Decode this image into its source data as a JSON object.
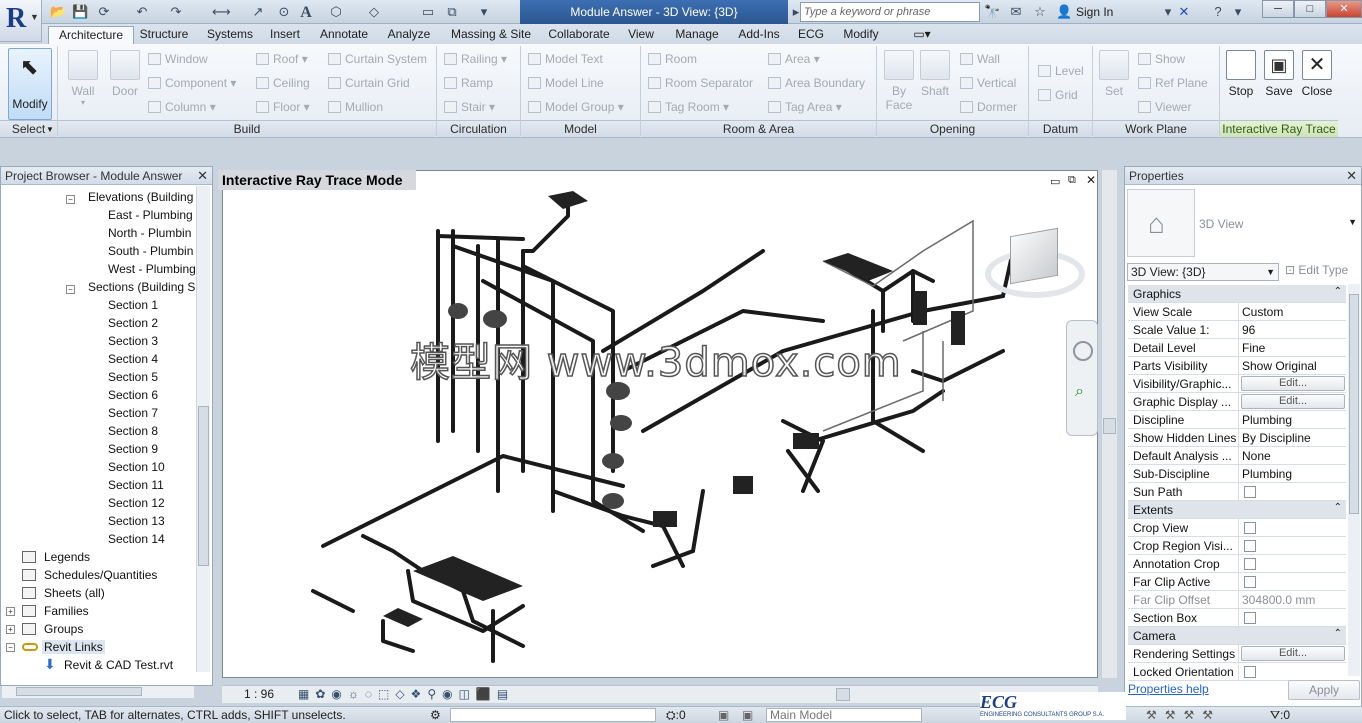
{
  "app": {
    "logo": "R",
    "title": "Module Answer - 3D View: {3D}",
    "search_placeholder": "Type a keyword or phrase",
    "sign_in": "Sign In"
  },
  "tabs": [
    "Architecture",
    "Structure",
    "Systems",
    "Insert",
    "Annotate",
    "Analyze",
    "Massing & Site",
    "Collaborate",
    "View",
    "Manage",
    "Add-Ins",
    "ECG",
    "Modify"
  ],
  "ribbon": {
    "modify": "Modify",
    "build": {
      "wall": "Wall",
      "door": "Door",
      "window": "Window",
      "component": "Component",
      "column": "Column",
      "roof": "Roof",
      "ceiling": "Ceiling",
      "floor": "Floor",
      "curtain_system": "Curtain System",
      "curtain_grid": "Curtain Grid",
      "mullion": "Mullion"
    },
    "circulation": {
      "railing": "Railing",
      "ramp": "Ramp",
      "stair": "Stair"
    },
    "model": {
      "text": "Model Text",
      "line": "Model Line",
      "group": "Model Group"
    },
    "room": {
      "room": "Room",
      "separator": "Room Separator",
      "tag_room": "Tag Room",
      "area": "Area",
      "boundary": "Area Boundary",
      "tag_area": "Tag Area"
    },
    "opening": {
      "by_face": "By Face",
      "shaft": "Shaft",
      "wall": "Wall",
      "vertical": "Vertical",
      "dormer": "Dormer"
    },
    "datum": {
      "level": "Level",
      "grid": "Grid"
    },
    "workplane": {
      "set": "Set",
      "show": "Show",
      "ref_plane": "Ref Plane",
      "viewer": "Viewer"
    },
    "irt": {
      "stop": "Stop",
      "save": "Save",
      "close": "Close"
    },
    "panels": {
      "select": "Select",
      "build": "Build",
      "circulation": "Circulation",
      "model": "Model",
      "room": "Room & Area",
      "opening": "Opening",
      "datum": "Datum",
      "workplane": "Work Plane",
      "irt": "Interactive Ray Trace"
    }
  },
  "browser": {
    "title": "Project Browser - Module Answer",
    "elevations": "Elevations (Building",
    "elev_items": [
      "East - Plumbing",
      "North - Plumbin",
      "South - Plumbin",
      "West - Plumbing"
    ],
    "sections": "Sections (Building S",
    "sect_items": [
      "Section 1",
      "Section 2",
      "Section 3",
      "Section 4",
      "Section 5",
      "Section 6",
      "Section 7",
      "Section 8",
      "Section 9",
      "Section 10",
      "Section 11",
      "Section 12",
      "Section 13",
      "Section 14"
    ],
    "others": [
      "Legends",
      "Schedules/Quantities",
      "Sheets (all)",
      "Families",
      "Groups",
      "Revit Links"
    ],
    "link_file": "Revit & CAD Test.rvt"
  },
  "view": {
    "title": "Interactive Ray Trace Mode",
    "watermark": "模型网 www.3dmox.com",
    "scale": "1 : 96"
  },
  "properties": {
    "title": "Properties",
    "type": "3D View",
    "selector": "3D View: {3D}",
    "edit_type": "Edit Type",
    "graphics": "Graphics",
    "rows1": [
      [
        "View Scale",
        "Custom"
      ],
      [
        "Scale Value    1:",
        "96"
      ],
      [
        "Detail Level",
        "Fine"
      ],
      [
        "Parts Visibility",
        "Show Original"
      ]
    ],
    "vis": "Visibility/Graphic...",
    "gdisp": "Graphic Display ...",
    "edit": "Edit...",
    "rows2": [
      [
        "Discipline",
        "Plumbing"
      ],
      [
        "Show Hidden Lines",
        "By Discipline"
      ],
      [
        "Default Analysis ...",
        "None"
      ],
      [
        "Sub-Discipline",
        "Plumbing"
      ]
    ],
    "sun": "Sun Path",
    "extents": "Extents",
    "ext_checks": [
      "Crop View",
      "Crop Region Visi...",
      "Annotation Crop",
      "Far Clip Active"
    ],
    "far_clip_offset": [
      "Far Clip Offset",
      "304800.0 mm"
    ],
    "section_box": "Section Box",
    "camera": "Camera",
    "rendering": "Rendering Settings",
    "locked": "Locked Orientation",
    "help": "Properties help",
    "apply": "Apply"
  },
  "status": {
    "hint": "Click to select, TAB for alternates, CTRL adds, SHIFT unselects.",
    "zero": ":0",
    "model": "Main Model",
    "filter": ":0"
  },
  "ecg": {
    "logo": "ECG",
    "sub": "ENGINEERING CONSULTANTS GROUP S.A."
  }
}
